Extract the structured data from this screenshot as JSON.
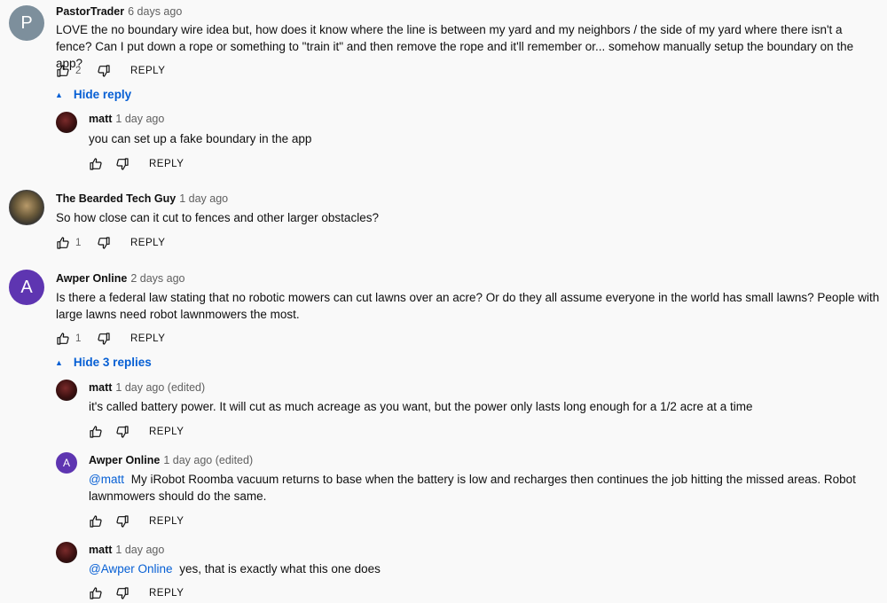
{
  "comments": [
    {
      "author": "PastorTrader",
      "time": "6 days ago",
      "avatar_letter": "P",
      "text": "LOVE the no boundary wire idea but, how does it know where the line is between my yard and my neighbors / the side of my yard where there isn't a fence? Can I put down a rope or something to \"train it\" and then remove the rope and it'll remember or... somehow manually setup the boundary on the app?",
      "likes": "2",
      "reply_label": "REPLY",
      "replies_toggle": "Hide reply",
      "replies": [
        {
          "author": "matt",
          "time": "1 day ago",
          "text": "you can set up a fake boundary in the app",
          "reply_label": "REPLY"
        }
      ]
    },
    {
      "author": "The Bearded Tech Guy",
      "time": "1 day ago",
      "text": "So how close can it cut to fences and other larger obstacles?",
      "likes": "1",
      "reply_label": "REPLY"
    },
    {
      "author": "Awper Online",
      "time": "2 days ago",
      "avatar_letter": "A",
      "text": "Is there a federal law stating that no robotic mowers can cut lawns over an acre?  Or do they all assume everyone in the world has small lawns?  People with large lawns need robot lawnmowers the most.",
      "likes": "1",
      "reply_label": "REPLY",
      "replies_toggle": "Hide 3 replies",
      "replies": [
        {
          "author": "matt",
          "time": "1 day ago (edited)",
          "text": "it's called battery power.  It will cut as much acreage as you want, but the power only lasts long enough for a 1/2 acre at a time",
          "reply_label": "REPLY"
        },
        {
          "author": "Awper Online",
          "time": "1 day ago (edited)",
          "avatar_letter": "A",
          "mention": "@matt",
          "text": "My iRobot Roomba vacuum returns to base when the battery is low and recharges then continues the job hitting the missed areas.  Robot lawnmowers should do the same.",
          "reply_label": "REPLY"
        },
        {
          "author": "matt",
          "time": "1 day ago",
          "mention": "@Awper Online",
          "text": "yes, that is exactly what this one does",
          "reply_label": "REPLY"
        }
      ]
    }
  ],
  "icons": {
    "like": "thumb-up-icon",
    "dislike": "thumb-down-icon",
    "toggle": "triangle-up-icon"
  },
  "colors": {
    "link": "#065fd4",
    "muted": "#606060",
    "avatar_grey": "#7d8f9c",
    "avatar_purple": "#5e35b1"
  }
}
